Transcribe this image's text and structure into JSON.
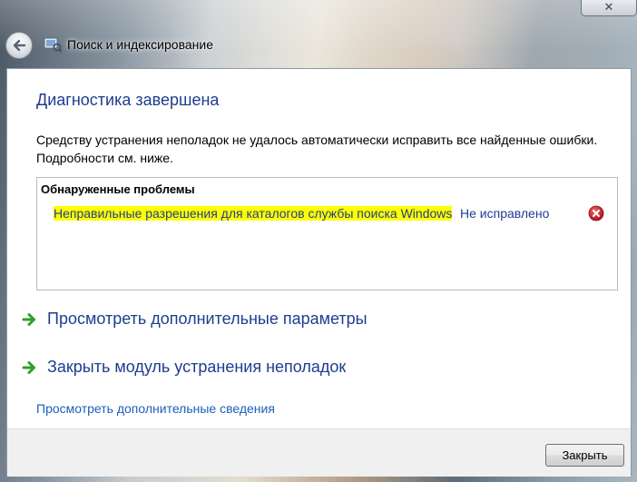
{
  "window": {
    "title": "Поиск и индексирование",
    "close_glyph": "✕"
  },
  "content": {
    "heading": "Диагностика завершена",
    "description": "Средству устранения неполадок не удалось автоматически исправить все найденные ошибки. Подробности см. ниже.",
    "problems_header": "Обнаруженные проблемы",
    "problems": [
      {
        "name": "Неправильные разрешения для каталогов службы поиска Windows",
        "status": "Не исправлено"
      }
    ],
    "actions": [
      {
        "label": "Просмотреть дополнительные параметры"
      },
      {
        "label": "Закрыть модуль устранения неполадок"
      }
    ],
    "details_link": "Просмотреть дополнительные сведения"
  },
  "footer": {
    "close_label": "Закрыть"
  },
  "colors": {
    "heading": "#1e3d8f",
    "link": "#1e5fb8",
    "highlight": "#ffff00",
    "action_arrow": "#2e9e2e",
    "error_icon": "#c8102e"
  },
  "icons": {
    "back": "back-arrow-icon",
    "title": "troubleshooter-icon",
    "error": "error-x-icon",
    "action": "green-arrow-icon"
  }
}
